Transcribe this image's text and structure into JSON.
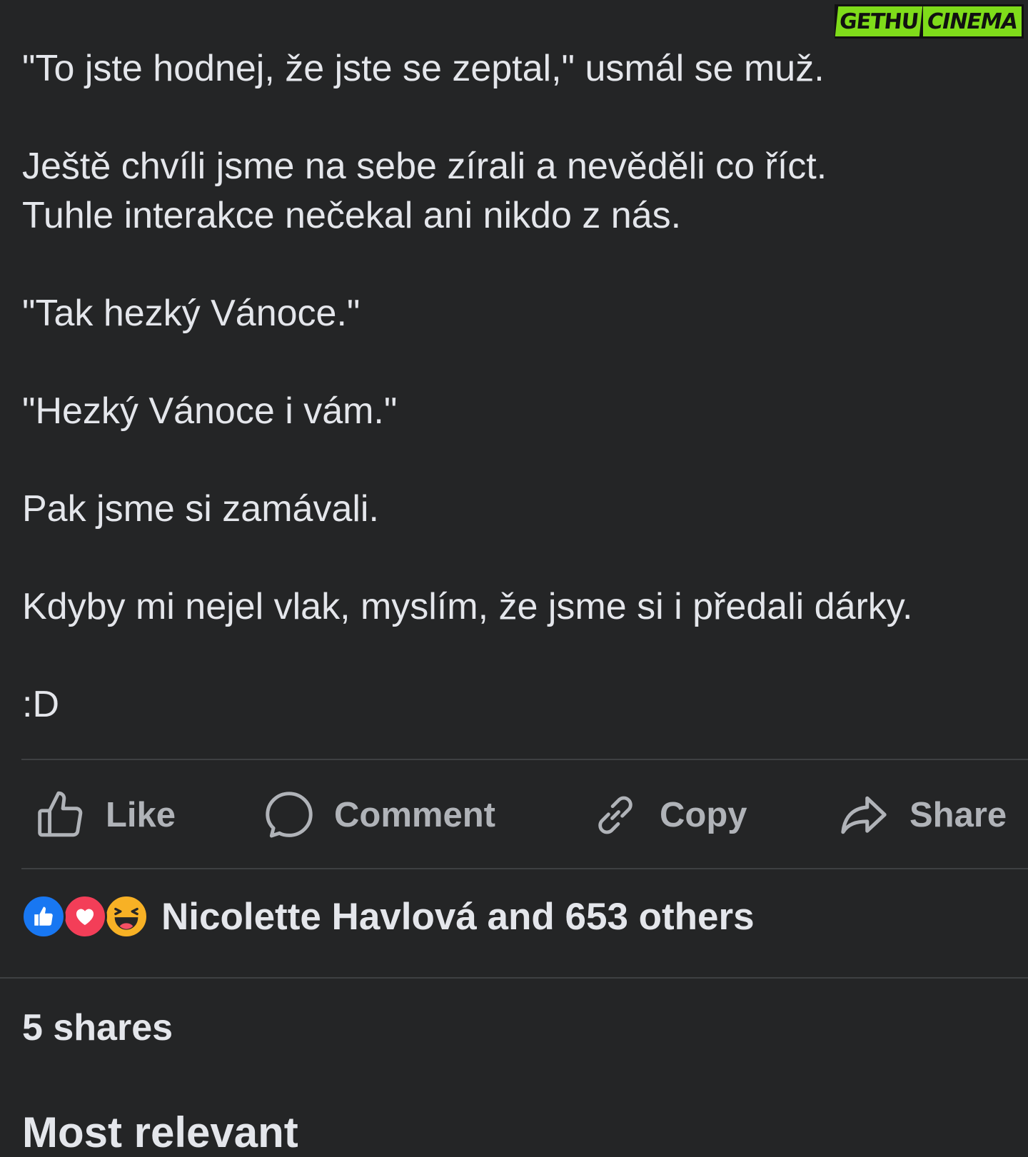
{
  "watermark": {
    "part1": "GETHU",
    "part2": "CINEMA"
  },
  "post": {
    "paragraphs": [
      "\"To jste hodnej, že jste se zeptal,\" usmál se muž.",
      "Ještě chvíli jsme na sebe zírali a nevěděli co říct.\nTuhle interakce nečekal ani nikdo z nás.",
      "\"Tak hezký Vánoce.\"",
      "\"Hezký Vánoce i vám.\"",
      "Pak jsme si zamávali.",
      "Kdyby mi nejel vlak, myslím, že jsme si i předali dárky.",
      ":D"
    ]
  },
  "actions": {
    "like": {
      "label": "Like",
      "icon": "thumbs-up-icon"
    },
    "comment": {
      "label": "Comment",
      "icon": "speech-bubble-icon"
    },
    "copy": {
      "label": "Copy",
      "icon": "link-icon"
    },
    "share": {
      "label": "Share",
      "icon": "share-arrow-icon"
    }
  },
  "reactions": {
    "icons": [
      "like-reaction-icon",
      "love-reaction-icon",
      "haha-reaction-icon"
    ],
    "summary": "Nicolette Havlová and 653 others"
  },
  "shares": {
    "text": "5 shares"
  },
  "cutoff": {
    "text": "Most relevant"
  },
  "colors": {
    "background": "#242526",
    "text": "#e4e6eb",
    "secondary_text": "#b0b3b8",
    "divider": "#3e4042",
    "like_blue": "#1877f2",
    "love_red": "#f33e58",
    "haha_yellow": "#f7b125"
  }
}
